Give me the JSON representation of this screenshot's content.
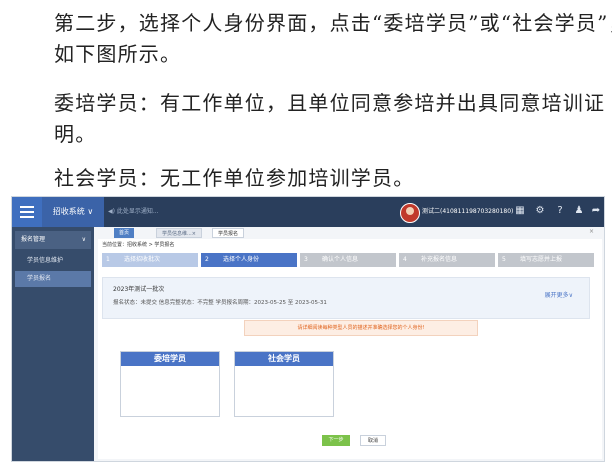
{
  "paragraphs": {
    "p1": "第二步，选择个人身份界面，点击“委培学员”或“社会学员”，如下图所示。",
    "p2": "委培学员：有工作单位，且单位同意参培并出具同意培训证明。",
    "p3": "社会学员：无工作单位参加培训学员。"
  },
  "screenshot": {
    "system_menu": "招收系统",
    "notice": "◀) 此处显示通知...",
    "user": "测试二(410811198703280180)",
    "sidebar": {
      "group": "报名管理",
      "items": [
        "学员信息维护",
        "学员报名"
      ]
    },
    "tabs": [
      "首页",
      "学员信息维...×",
      "学员报名"
    ],
    "breadcrumb": "当前位置：招收系统 > 学员报名",
    "steps": [
      {
        "num": "1",
        "label": "选择招收批次"
      },
      {
        "num": "2",
        "label": "选择个人身份"
      },
      {
        "num": "3",
        "label": "确认个人信息"
      },
      {
        "num": "4",
        "label": "补充报名信息"
      },
      {
        "num": "5",
        "label": "填写志愿并上报"
      }
    ],
    "batch_title": "2023年测试一批次",
    "batch_status": "报名状态：未提交    信息完整状态：不完整    学员报名周期：2023-05-25 至 2023-05-31",
    "expand_more": "展开更多∨",
    "warning": "请详细阅读每种类型人员的描述并准确选择您的个人身份!",
    "cards": [
      "委培学员",
      "社会学员"
    ],
    "next_button": "下一步",
    "cancel_button": "取消"
  },
  "colors": {
    "topbar": "#2a3e5c",
    "accent": "#4a74c6",
    "sidebar": "#364c6b",
    "warning_text": "#e0631d",
    "next_button": "#7cc24a"
  }
}
